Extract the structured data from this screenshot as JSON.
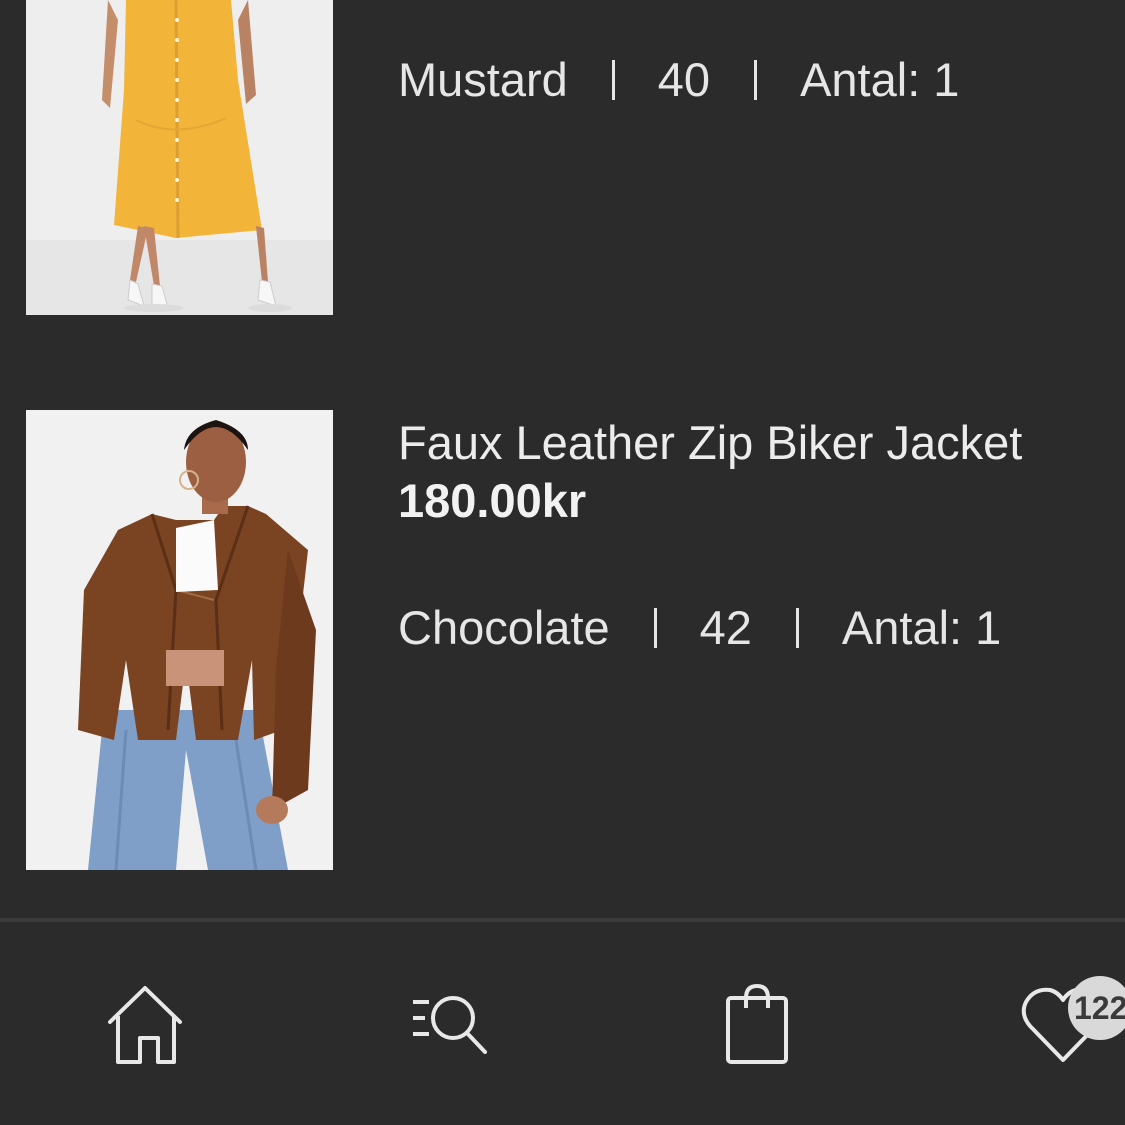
{
  "items": [
    {
      "title": "",
      "price": "",
      "color": "Mustard",
      "size": "40",
      "quantity": "Antal: 1",
      "image_desc_color": "#f2b53a"
    },
    {
      "title": "Faux Leather Zip Biker Jacket",
      "price": "180.00kr",
      "color": "Chocolate",
      "size": "42",
      "quantity": "Antal: 1",
      "image_desc_color": "#7a4322"
    }
  ],
  "nav": {
    "home_icon": "home-icon",
    "search_icon": "search-list-icon",
    "bag_icon": "shopping-bag-icon",
    "wishlist_icon": "heart-icon",
    "wishlist_count": "122"
  },
  "colors": {
    "background": "#2b2b2c",
    "text": "#e8e8e8",
    "badge": "#d9d9d9"
  }
}
